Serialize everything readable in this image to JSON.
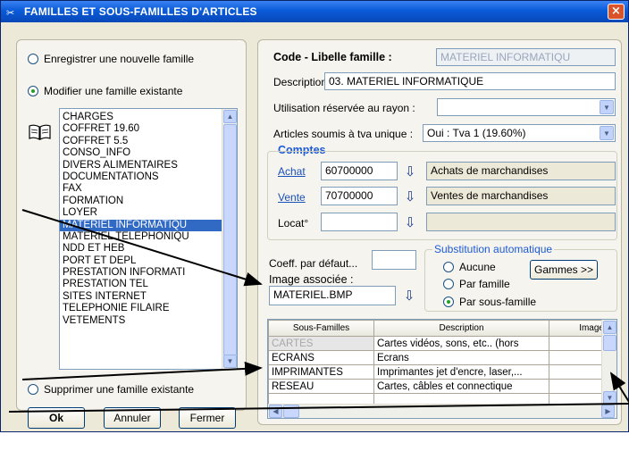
{
  "window": {
    "title": "FAMILLES ET SOUS-FAMILLES D'ARTICLES",
    "close_label": "×"
  },
  "left": {
    "radio_new": "Enregistrer une nouvelle famille",
    "radio_modify": "Modifier une famille existante",
    "radio_delete": "Supprimer une famille existante",
    "selected_radio": "modify",
    "families": [
      "CHARGES",
      "COFFRET 19.60",
      "COFFRET 5.5",
      "CONSO_INFO",
      "DIVERS ALIMENTAIRES",
      "DOCUMENTATIONS",
      "FAX",
      "FORMATION",
      "LOYER",
      "MATERIEL INFORMATIQU",
      "MATERIEL TELEPHONIQU",
      "NDD ET HEB",
      "PORT ET DEPL",
      "PRESTATION INFORMATI",
      "PRESTATION TEL",
      "SITES INTERNET",
      "TELEPHONIE FILAIRE",
      "VETEMENTS"
    ],
    "selected_family": "MATERIEL INFORMATIQU",
    "ok_label": "Ok",
    "cancel_label": "Annuler",
    "close_label": "Fermer"
  },
  "right": {
    "code_label": "Code - Libelle famille :",
    "code_value": "MATERIEL INFORMATIQU",
    "description_label": "Description :",
    "description_value": "03. MATERIEL INFORMATIQUE",
    "rayon_label": "Utilisation réservée au rayon :",
    "rayon_value": "",
    "tva_label": "Articles soumis à tva unique :",
    "tva_value": "Oui : Tva 1 (19.60%)",
    "comptes_title": "Comptes",
    "achat_label": "Achat",
    "achat_account": "60700000",
    "achat_desc": "Achats de marchandises",
    "vente_label": "Vente",
    "vente_account": "70700000",
    "vente_desc": "Ventes de marchandises",
    "locat_label": "Locat°",
    "locat_account": "",
    "locat_desc": "",
    "coeff_label": "Coeff. par défaut...",
    "coeff_value": "",
    "image_label": "Image associée :",
    "image_value": "MATERIEL.BMP",
    "subst_title": "Substitution automatique",
    "subst_none": "Aucune",
    "subst_family": "Par famille",
    "subst_subfamily": "Par sous-famille",
    "subst_selected": "subfamily",
    "gammes_label": "Gammes >>"
  },
  "grid": {
    "columns": [
      "Sous-Familles",
      "Description",
      "Image"
    ],
    "rows": [
      [
        "CARTES",
        "Cartes vidéos, sons, etc.. (hors",
        ""
      ],
      [
        "ECRANS",
        "Ecrans",
        ""
      ],
      [
        "IMPRIMANTES",
        "Imprimantes jet d'encre, laser,...",
        ""
      ],
      [
        "RESEAU",
        "Cartes, câbles et connectique",
        ""
      ],
      [
        "",
        "",
        ""
      ]
    ]
  },
  "icons": {
    "title_icon": "scissors-icon",
    "book_icon": "book-icon",
    "lookup_icon": "down-arrow-icon"
  },
  "colors": {
    "title_bar": "#0a5bd8",
    "selection": "#316ac5",
    "close_button": "#d9542b"
  }
}
